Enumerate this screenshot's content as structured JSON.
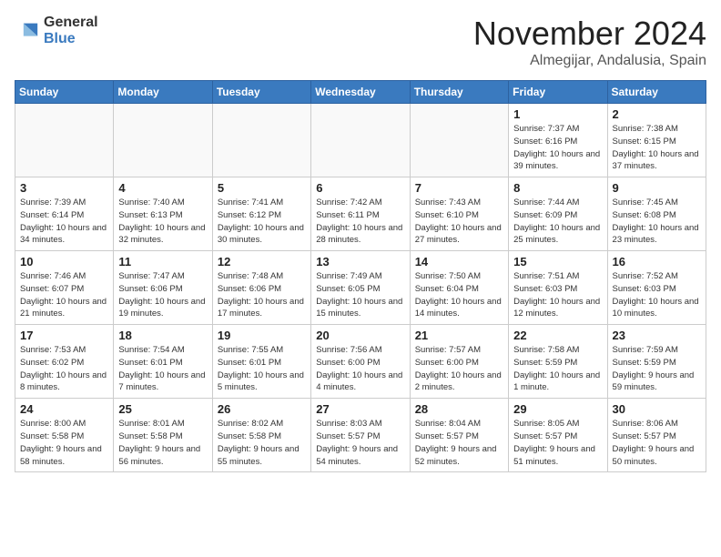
{
  "logo": {
    "general": "General",
    "blue": "Blue"
  },
  "title": {
    "month": "November 2024",
    "location": "Almegijar, Andalusia, Spain"
  },
  "days_of_week": [
    "Sunday",
    "Monday",
    "Tuesday",
    "Wednesday",
    "Thursday",
    "Friday",
    "Saturday"
  ],
  "weeks": [
    [
      {
        "day": "",
        "info": ""
      },
      {
        "day": "",
        "info": ""
      },
      {
        "day": "",
        "info": ""
      },
      {
        "day": "",
        "info": ""
      },
      {
        "day": "",
        "info": ""
      },
      {
        "day": "1",
        "info": "Sunrise: 7:37 AM\nSunset: 6:16 PM\nDaylight: 10 hours and 39 minutes."
      },
      {
        "day": "2",
        "info": "Sunrise: 7:38 AM\nSunset: 6:15 PM\nDaylight: 10 hours and 37 minutes."
      }
    ],
    [
      {
        "day": "3",
        "info": "Sunrise: 7:39 AM\nSunset: 6:14 PM\nDaylight: 10 hours and 34 minutes."
      },
      {
        "day": "4",
        "info": "Sunrise: 7:40 AM\nSunset: 6:13 PM\nDaylight: 10 hours and 32 minutes."
      },
      {
        "day": "5",
        "info": "Sunrise: 7:41 AM\nSunset: 6:12 PM\nDaylight: 10 hours and 30 minutes."
      },
      {
        "day": "6",
        "info": "Sunrise: 7:42 AM\nSunset: 6:11 PM\nDaylight: 10 hours and 28 minutes."
      },
      {
        "day": "7",
        "info": "Sunrise: 7:43 AM\nSunset: 6:10 PM\nDaylight: 10 hours and 27 minutes."
      },
      {
        "day": "8",
        "info": "Sunrise: 7:44 AM\nSunset: 6:09 PM\nDaylight: 10 hours and 25 minutes."
      },
      {
        "day": "9",
        "info": "Sunrise: 7:45 AM\nSunset: 6:08 PM\nDaylight: 10 hours and 23 minutes."
      }
    ],
    [
      {
        "day": "10",
        "info": "Sunrise: 7:46 AM\nSunset: 6:07 PM\nDaylight: 10 hours and 21 minutes."
      },
      {
        "day": "11",
        "info": "Sunrise: 7:47 AM\nSunset: 6:06 PM\nDaylight: 10 hours and 19 minutes."
      },
      {
        "day": "12",
        "info": "Sunrise: 7:48 AM\nSunset: 6:06 PM\nDaylight: 10 hours and 17 minutes."
      },
      {
        "day": "13",
        "info": "Sunrise: 7:49 AM\nSunset: 6:05 PM\nDaylight: 10 hours and 15 minutes."
      },
      {
        "day": "14",
        "info": "Sunrise: 7:50 AM\nSunset: 6:04 PM\nDaylight: 10 hours and 14 minutes."
      },
      {
        "day": "15",
        "info": "Sunrise: 7:51 AM\nSunset: 6:03 PM\nDaylight: 10 hours and 12 minutes."
      },
      {
        "day": "16",
        "info": "Sunrise: 7:52 AM\nSunset: 6:03 PM\nDaylight: 10 hours and 10 minutes."
      }
    ],
    [
      {
        "day": "17",
        "info": "Sunrise: 7:53 AM\nSunset: 6:02 PM\nDaylight: 10 hours and 8 minutes."
      },
      {
        "day": "18",
        "info": "Sunrise: 7:54 AM\nSunset: 6:01 PM\nDaylight: 10 hours and 7 minutes."
      },
      {
        "day": "19",
        "info": "Sunrise: 7:55 AM\nSunset: 6:01 PM\nDaylight: 10 hours and 5 minutes."
      },
      {
        "day": "20",
        "info": "Sunrise: 7:56 AM\nSunset: 6:00 PM\nDaylight: 10 hours and 4 minutes."
      },
      {
        "day": "21",
        "info": "Sunrise: 7:57 AM\nSunset: 6:00 PM\nDaylight: 10 hours and 2 minutes."
      },
      {
        "day": "22",
        "info": "Sunrise: 7:58 AM\nSunset: 5:59 PM\nDaylight: 10 hours and 1 minute."
      },
      {
        "day": "23",
        "info": "Sunrise: 7:59 AM\nSunset: 5:59 PM\nDaylight: 9 hours and 59 minutes."
      }
    ],
    [
      {
        "day": "24",
        "info": "Sunrise: 8:00 AM\nSunset: 5:58 PM\nDaylight: 9 hours and 58 minutes."
      },
      {
        "day": "25",
        "info": "Sunrise: 8:01 AM\nSunset: 5:58 PM\nDaylight: 9 hours and 56 minutes."
      },
      {
        "day": "26",
        "info": "Sunrise: 8:02 AM\nSunset: 5:58 PM\nDaylight: 9 hours and 55 minutes."
      },
      {
        "day": "27",
        "info": "Sunrise: 8:03 AM\nSunset: 5:57 PM\nDaylight: 9 hours and 54 minutes."
      },
      {
        "day": "28",
        "info": "Sunrise: 8:04 AM\nSunset: 5:57 PM\nDaylight: 9 hours and 52 minutes."
      },
      {
        "day": "29",
        "info": "Sunrise: 8:05 AM\nSunset: 5:57 PM\nDaylight: 9 hours and 51 minutes."
      },
      {
        "day": "30",
        "info": "Sunrise: 8:06 AM\nSunset: 5:57 PM\nDaylight: 9 hours and 50 minutes."
      }
    ]
  ]
}
